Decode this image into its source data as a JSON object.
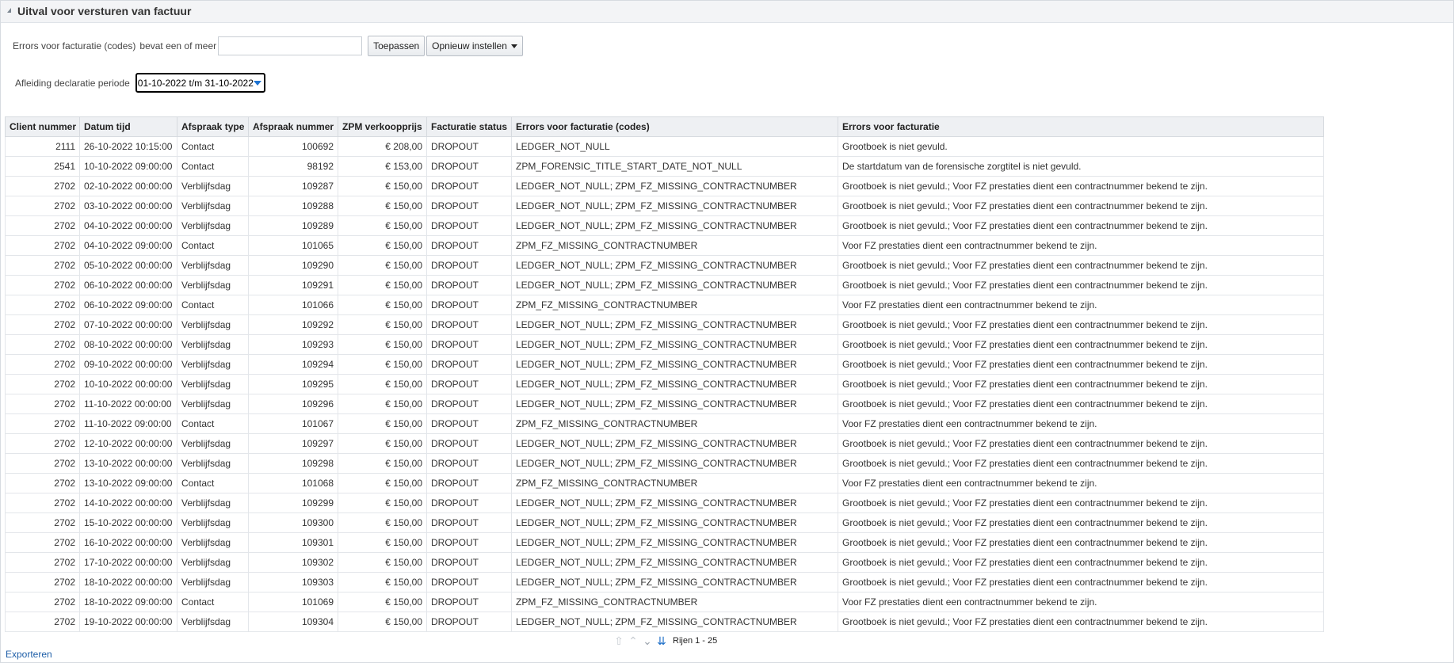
{
  "panel": {
    "title": "Uitval voor versturen van factuur"
  },
  "filter": {
    "field_label": "Errors voor facturatie (codes)",
    "operator_label": "bevat een of meer",
    "input_value": "",
    "apply_label": "Toepassen",
    "reset_label": "Opnieuw instellen"
  },
  "period": {
    "label": "Afleiding declaratie periode",
    "selected": "01-10-2022 t/m 31-10-2022"
  },
  "table": {
    "columns": [
      "Client nummer",
      "Datum tijd",
      "Afspraak type",
      "Afspraak nummer",
      "ZPM verkoopprijs",
      "Facturatie status",
      "Errors voor facturatie (codes)",
      "Errors voor facturatie"
    ],
    "rows": [
      [
        "2111",
        "26-10-2022 10:15:00",
        "Contact",
        "100692",
        "€ 208,00",
        "DROPOUT",
        "LEDGER_NOT_NULL",
        "Grootboek is niet gevuld."
      ],
      [
        "2541",
        "10-10-2022 09:00:00",
        "Contact",
        "98192",
        "€ 153,00",
        "DROPOUT",
        "ZPM_FORENSIC_TITLE_START_DATE_NOT_NULL",
        "De startdatum van de forensische zorgtitel is niet gevuld."
      ],
      [
        "2702",
        "02-10-2022 00:00:00",
        "Verblijfsdag",
        "109287",
        "€ 150,00",
        "DROPOUT",
        "LEDGER_NOT_NULL; ZPM_FZ_MISSING_CONTRACTNUMBER",
        "Grootboek is niet gevuld.; Voor FZ prestaties dient een contractnummer bekend te zijn."
      ],
      [
        "2702",
        "03-10-2022 00:00:00",
        "Verblijfsdag",
        "109288",
        "€ 150,00",
        "DROPOUT",
        "LEDGER_NOT_NULL; ZPM_FZ_MISSING_CONTRACTNUMBER",
        "Grootboek is niet gevuld.; Voor FZ prestaties dient een contractnummer bekend te zijn."
      ],
      [
        "2702",
        "04-10-2022 00:00:00",
        "Verblijfsdag",
        "109289",
        "€ 150,00",
        "DROPOUT",
        "LEDGER_NOT_NULL; ZPM_FZ_MISSING_CONTRACTNUMBER",
        "Grootboek is niet gevuld.; Voor FZ prestaties dient een contractnummer bekend te zijn."
      ],
      [
        "2702",
        "04-10-2022 09:00:00",
        "Contact",
        "101065",
        "€ 150,00",
        "DROPOUT",
        "ZPM_FZ_MISSING_CONTRACTNUMBER",
        "Voor FZ prestaties dient een contractnummer bekend te zijn."
      ],
      [
        "2702",
        "05-10-2022 00:00:00",
        "Verblijfsdag",
        "109290",
        "€ 150,00",
        "DROPOUT",
        "LEDGER_NOT_NULL; ZPM_FZ_MISSING_CONTRACTNUMBER",
        "Grootboek is niet gevuld.; Voor FZ prestaties dient een contractnummer bekend te zijn."
      ],
      [
        "2702",
        "06-10-2022 00:00:00",
        "Verblijfsdag",
        "109291",
        "€ 150,00",
        "DROPOUT",
        "LEDGER_NOT_NULL; ZPM_FZ_MISSING_CONTRACTNUMBER",
        "Grootboek is niet gevuld.; Voor FZ prestaties dient een contractnummer bekend te zijn."
      ],
      [
        "2702",
        "06-10-2022 09:00:00",
        "Contact",
        "101066",
        "€ 150,00",
        "DROPOUT",
        "ZPM_FZ_MISSING_CONTRACTNUMBER",
        "Voor FZ prestaties dient een contractnummer bekend te zijn."
      ],
      [
        "2702",
        "07-10-2022 00:00:00",
        "Verblijfsdag",
        "109292",
        "€ 150,00",
        "DROPOUT",
        "LEDGER_NOT_NULL; ZPM_FZ_MISSING_CONTRACTNUMBER",
        "Grootboek is niet gevuld.; Voor FZ prestaties dient een contractnummer bekend te zijn."
      ],
      [
        "2702",
        "08-10-2022 00:00:00",
        "Verblijfsdag",
        "109293",
        "€ 150,00",
        "DROPOUT",
        "LEDGER_NOT_NULL; ZPM_FZ_MISSING_CONTRACTNUMBER",
        "Grootboek is niet gevuld.; Voor FZ prestaties dient een contractnummer bekend te zijn."
      ],
      [
        "2702",
        "09-10-2022 00:00:00",
        "Verblijfsdag",
        "109294",
        "€ 150,00",
        "DROPOUT",
        "LEDGER_NOT_NULL; ZPM_FZ_MISSING_CONTRACTNUMBER",
        "Grootboek is niet gevuld.; Voor FZ prestaties dient een contractnummer bekend te zijn."
      ],
      [
        "2702",
        "10-10-2022 00:00:00",
        "Verblijfsdag",
        "109295",
        "€ 150,00",
        "DROPOUT",
        "LEDGER_NOT_NULL; ZPM_FZ_MISSING_CONTRACTNUMBER",
        "Grootboek is niet gevuld.; Voor FZ prestaties dient een contractnummer bekend te zijn."
      ],
      [
        "2702",
        "11-10-2022 00:00:00",
        "Verblijfsdag",
        "109296",
        "€ 150,00",
        "DROPOUT",
        "LEDGER_NOT_NULL; ZPM_FZ_MISSING_CONTRACTNUMBER",
        "Grootboek is niet gevuld.; Voor FZ prestaties dient een contractnummer bekend te zijn."
      ],
      [
        "2702",
        "11-10-2022 09:00:00",
        "Contact",
        "101067",
        "€ 150,00",
        "DROPOUT",
        "ZPM_FZ_MISSING_CONTRACTNUMBER",
        "Voor FZ prestaties dient een contractnummer bekend te zijn."
      ],
      [
        "2702",
        "12-10-2022 00:00:00",
        "Verblijfsdag",
        "109297",
        "€ 150,00",
        "DROPOUT",
        "LEDGER_NOT_NULL; ZPM_FZ_MISSING_CONTRACTNUMBER",
        "Grootboek is niet gevuld.; Voor FZ prestaties dient een contractnummer bekend te zijn."
      ],
      [
        "2702",
        "13-10-2022 00:00:00",
        "Verblijfsdag",
        "109298",
        "€ 150,00",
        "DROPOUT",
        "LEDGER_NOT_NULL; ZPM_FZ_MISSING_CONTRACTNUMBER",
        "Grootboek is niet gevuld.; Voor FZ prestaties dient een contractnummer bekend te zijn."
      ],
      [
        "2702",
        "13-10-2022 09:00:00",
        "Contact",
        "101068",
        "€ 150,00",
        "DROPOUT",
        "ZPM_FZ_MISSING_CONTRACTNUMBER",
        "Voor FZ prestaties dient een contractnummer bekend te zijn."
      ],
      [
        "2702",
        "14-10-2022 00:00:00",
        "Verblijfsdag",
        "109299",
        "€ 150,00",
        "DROPOUT",
        "LEDGER_NOT_NULL; ZPM_FZ_MISSING_CONTRACTNUMBER",
        "Grootboek is niet gevuld.; Voor FZ prestaties dient een contractnummer bekend te zijn."
      ],
      [
        "2702",
        "15-10-2022 00:00:00",
        "Verblijfsdag",
        "109300",
        "€ 150,00",
        "DROPOUT",
        "LEDGER_NOT_NULL; ZPM_FZ_MISSING_CONTRACTNUMBER",
        "Grootboek is niet gevuld.; Voor FZ prestaties dient een contractnummer bekend te zijn."
      ],
      [
        "2702",
        "16-10-2022 00:00:00",
        "Verblijfsdag",
        "109301",
        "€ 150,00",
        "DROPOUT",
        "LEDGER_NOT_NULL; ZPM_FZ_MISSING_CONTRACTNUMBER",
        "Grootboek is niet gevuld.; Voor FZ prestaties dient een contractnummer bekend te zijn."
      ],
      [
        "2702",
        "17-10-2022 00:00:00",
        "Verblijfsdag",
        "109302",
        "€ 150,00",
        "DROPOUT",
        "LEDGER_NOT_NULL; ZPM_FZ_MISSING_CONTRACTNUMBER",
        "Grootboek is niet gevuld.; Voor FZ prestaties dient een contractnummer bekend te zijn."
      ],
      [
        "2702",
        "18-10-2022 00:00:00",
        "Verblijfsdag",
        "109303",
        "€ 150,00",
        "DROPOUT",
        "LEDGER_NOT_NULL; ZPM_FZ_MISSING_CONTRACTNUMBER",
        "Grootboek is niet gevuld.; Voor FZ prestaties dient een contractnummer bekend te zijn."
      ],
      [
        "2702",
        "18-10-2022 09:00:00",
        "Contact",
        "101069",
        "€ 150,00",
        "DROPOUT",
        "ZPM_FZ_MISSING_CONTRACTNUMBER",
        "Voor FZ prestaties dient een contractnummer bekend te zijn."
      ],
      [
        "2702",
        "19-10-2022 00:00:00",
        "Verblijfsdag",
        "109304",
        "€ 150,00",
        "DROPOUT",
        "LEDGER_NOT_NULL; ZPM_FZ_MISSING_CONTRACTNUMBER",
        "Grootboek is niet gevuld.; Voor FZ prestaties dient een contractnummer bekend te zijn."
      ]
    ]
  },
  "pager": {
    "label": "Rijen 1 - 25",
    "icons": [
      "first-page-icon",
      "previous-page-icon",
      "next-page-icon",
      "last-page-icon"
    ]
  },
  "footer": {
    "export_label": "Exporteren"
  },
  "colors": {
    "link": "#1f5fa8",
    "select_arrow": "#1e73d1",
    "header_bg": "#eef0f3"
  }
}
